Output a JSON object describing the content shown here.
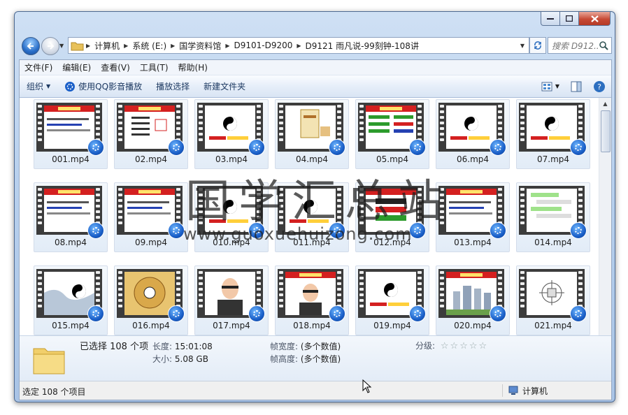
{
  "window": {
    "controls": [
      "minimize",
      "maximize",
      "close"
    ]
  },
  "address": {
    "crumbs": [
      "计算机",
      "系统 (E:)",
      "国学资料馆",
      "D9101-D9200",
      "D9121 雨凡说-99刻钟-108讲"
    ],
    "search_placeholder": "搜索 D912..."
  },
  "menu": [
    "文件(F)",
    "编辑(E)",
    "查看(V)",
    "工具(T)",
    "帮助(H)"
  ],
  "toolbar": {
    "organize": "组织",
    "play_qq": "使用QQ影音播放",
    "playlist": "播放选择",
    "new_folder": "新建文件夹"
  },
  "files": [
    {
      "name": "001.mp4",
      "thumb": "slide-red-title"
    },
    {
      "name": "02.mp4",
      "thumb": "slide-list"
    },
    {
      "name": "03.mp4",
      "thumb": "yinyang"
    },
    {
      "name": "04.mp4",
      "thumb": "book"
    },
    {
      "name": "05.mp4",
      "thumb": "slide-green"
    },
    {
      "name": "06.mp4",
      "thumb": "yinyang"
    },
    {
      "name": "07.mp4",
      "thumb": "yinyang"
    },
    {
      "name": "08.mp4",
      "thumb": "slide-red-title"
    },
    {
      "name": "09.mp4",
      "thumb": "slide-red-title"
    },
    {
      "name": "010.mp4",
      "thumb": "yinyang"
    },
    {
      "name": "011.mp4",
      "thumb": "yinyang"
    },
    {
      "name": "012.mp4",
      "thumb": "slide-teacher"
    },
    {
      "name": "013.mp4",
      "thumb": "slide-red-title"
    },
    {
      "name": "014.mp4",
      "thumb": "chat"
    },
    {
      "name": "015.mp4",
      "thumb": "yinyang-art"
    },
    {
      "name": "016.mp4",
      "thumb": "bagua"
    },
    {
      "name": "017.mp4",
      "thumb": "person"
    },
    {
      "name": "018.mp4",
      "thumb": "person-red"
    },
    {
      "name": "019.mp4",
      "thumb": "yinyang"
    },
    {
      "name": "020.mp4",
      "thumb": "buildings"
    },
    {
      "name": "021.mp4",
      "thumb": "diagram"
    }
  ],
  "details": {
    "selected": "已选择 108 个项",
    "length_label": "长度:",
    "length": "15:01:08",
    "size_label": "大小:",
    "size": "5.08 GB",
    "fw_label": "帧宽度:",
    "fw": "(多个数值)",
    "fh_label": "帧高度:",
    "fh": "(多个数值)",
    "rating_label": "分级:"
  },
  "status": {
    "left": "选定 108 个项目",
    "right": "计算机"
  },
  "watermark": {
    "title": "国学汇总站",
    "url": "www.guoxuehuizong.com"
  }
}
